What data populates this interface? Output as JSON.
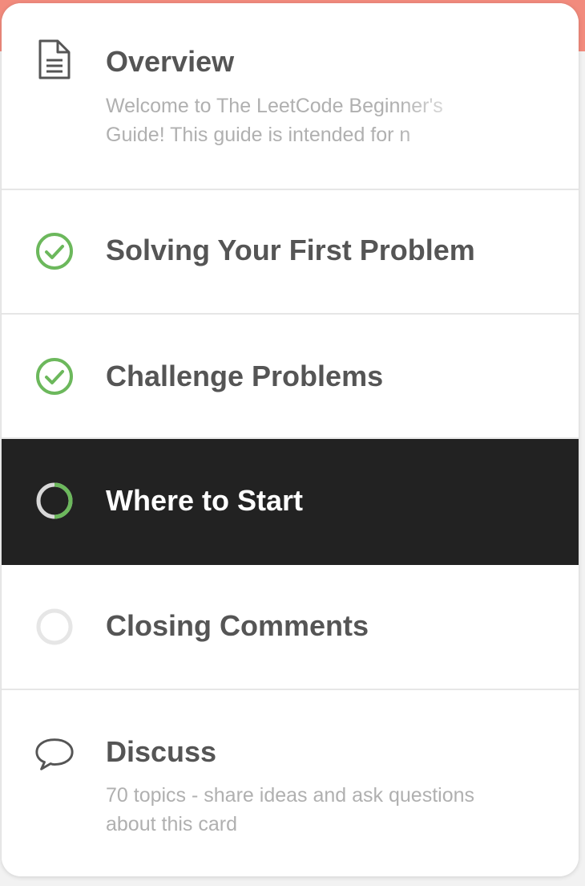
{
  "colors": {
    "accent_band": "#f28b7d",
    "complete_green": "#6cb85c",
    "active_bg": "#222222",
    "title_gray": "#555555",
    "desc_gray": "#b0b0b0"
  },
  "items": [
    {
      "icon": "document-icon",
      "title": "Overview",
      "description_line1": "Welcome to The LeetCode Beginner's",
      "description_line2": "Guide! This guide is intended for n"
    },
    {
      "icon": "check-circle-icon",
      "status": "complete",
      "title": "Solving Your First Problem"
    },
    {
      "icon": "check-circle-icon",
      "status": "complete",
      "title": "Challenge Problems"
    },
    {
      "icon": "progress-circle-icon",
      "status": "in-progress",
      "progress": 0.5,
      "title": "Where to Start"
    },
    {
      "icon": "empty-circle-icon",
      "status": "not-started",
      "title": "Closing Comments"
    },
    {
      "icon": "chat-bubble-icon",
      "title": "Discuss",
      "description_line1": "70 topics - share ideas and ask questions",
      "description_line2": "about this card"
    }
  ]
}
